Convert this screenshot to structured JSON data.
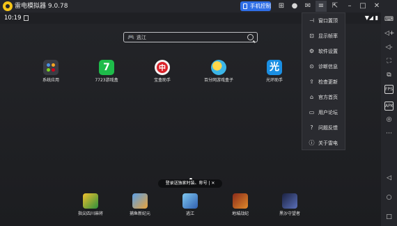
{
  "titlebar": {
    "app_title": "雷电模拟器 9.0.78",
    "phone_control_label": "手机控制",
    "icons": [
      "gamepad-icon",
      "user-icon",
      "mail-icon",
      "menu-icon",
      "sidebar-toggle-icon",
      "minimize-icon",
      "maximize-icon",
      "close-icon"
    ]
  },
  "statusbar": {
    "time": "10:19",
    "signal": "▼◢ ▮"
  },
  "search": {
    "value": "逃江"
  },
  "apps": [
    {
      "label": "系统应用",
      "icon": "system-apps-icon"
    },
    {
      "label": "7723游戏盒",
      "icon": "7723-icon",
      "glyph": "7"
    },
    {
      "label": "宝盒助手",
      "icon": "baoku-icon",
      "glyph": "中"
    },
    {
      "label": "百分网游戏盒子",
      "icon": "baifen-icon"
    },
    {
      "label": "光环助手",
      "icon": "guanghuan-icon",
      "glyph": "光"
    }
  ],
  "toast": {
    "text": "登录送独家时装、称号 | ✕"
  },
  "dock": [
    {
      "label": "指尖四川麻将"
    },
    {
      "label": "捕鱼新纪元"
    },
    {
      "label": "逃江"
    },
    {
      "label": "地城战纪"
    },
    {
      "label": "黑沙守望者"
    }
  ],
  "menu": {
    "items": [
      {
        "label": "窗口置顶",
        "icon": "pin-icon",
        "glyph": "⊣"
      },
      {
        "label": "显示帧率",
        "icon": "fps-icon",
        "glyph": "⊡"
      },
      {
        "label": "软件设置",
        "icon": "settings-icon",
        "glyph": "⚙"
      },
      {
        "label": "诊断信息",
        "icon": "diagnose-icon",
        "glyph": "⊙"
      },
      {
        "label": "检查更新",
        "icon": "update-icon",
        "glyph": "⇪"
      },
      {
        "label": "官方首页",
        "icon": "home-icon",
        "glyph": "⌂"
      },
      {
        "label": "用户论坛",
        "icon": "forum-icon",
        "glyph": "▭"
      },
      {
        "label": "问题反馈",
        "icon": "feedback-icon",
        "glyph": "?"
      },
      {
        "label": "关于雷电",
        "icon": "about-icon",
        "glyph": "ⓘ"
      }
    ]
  },
  "sidebar": {
    "fps_badge": "FPS",
    "apk_badge": "APK"
  }
}
